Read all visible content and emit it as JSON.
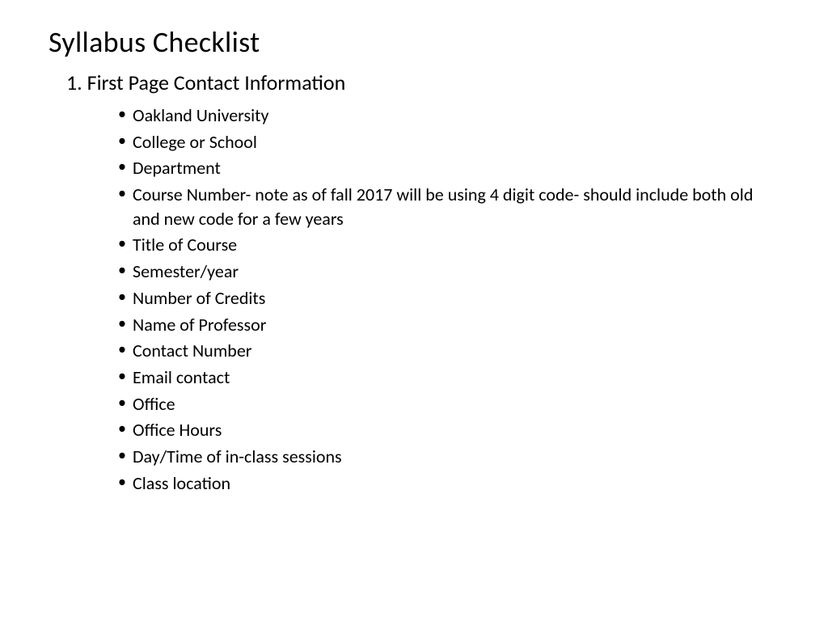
{
  "title": "Syllabus Checklist",
  "section": {
    "number": "1.",
    "heading": "First Page Contact Information",
    "full_heading": "1. First Page Contact Information"
  },
  "bullets": [
    "Oakland University",
    "College or School",
    "Department",
    "Course Number- note as of fall 2017 will be using 4 digit code- should include both old and new code for a few years",
    "Title of Course",
    "Semester/year",
    "Number of Credits",
    "Name of Professor",
    "Contact Number",
    "Email contact",
    "Office",
    "Office Hours",
    "Day/Time of in-class sessions",
    "Class location"
  ]
}
